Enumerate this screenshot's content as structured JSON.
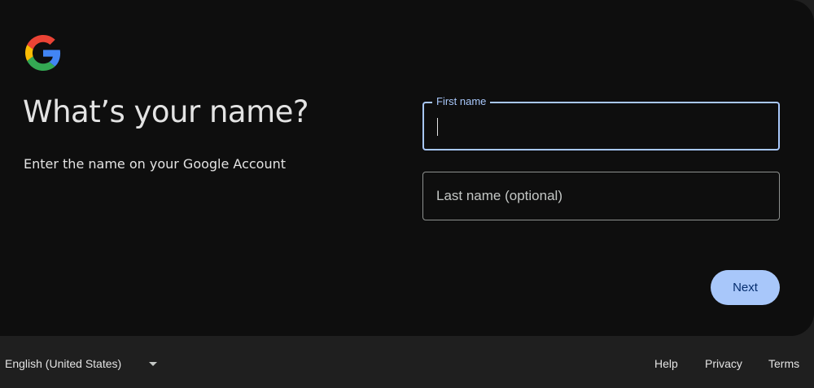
{
  "brand": {
    "logo_icon": "google-g-icon",
    "colors": {
      "blue": "#4285F4",
      "red": "#EA4335",
      "yellow": "#FBBC05",
      "green": "#34A853",
      "accent": "#a8c7fa"
    }
  },
  "page": {
    "title": "What’s your name?",
    "subtitle": "Enter the name on your Google Account"
  },
  "form": {
    "first_name": {
      "label": "First name",
      "value": ""
    },
    "last_name": {
      "placeholder": "Last name (optional)",
      "value": ""
    },
    "next_label": "Next"
  },
  "footer": {
    "language": "English (United States)",
    "dropdown_icon": "caret-down-icon",
    "links": {
      "help": "Help",
      "privacy": "Privacy",
      "terms": "Terms"
    }
  }
}
